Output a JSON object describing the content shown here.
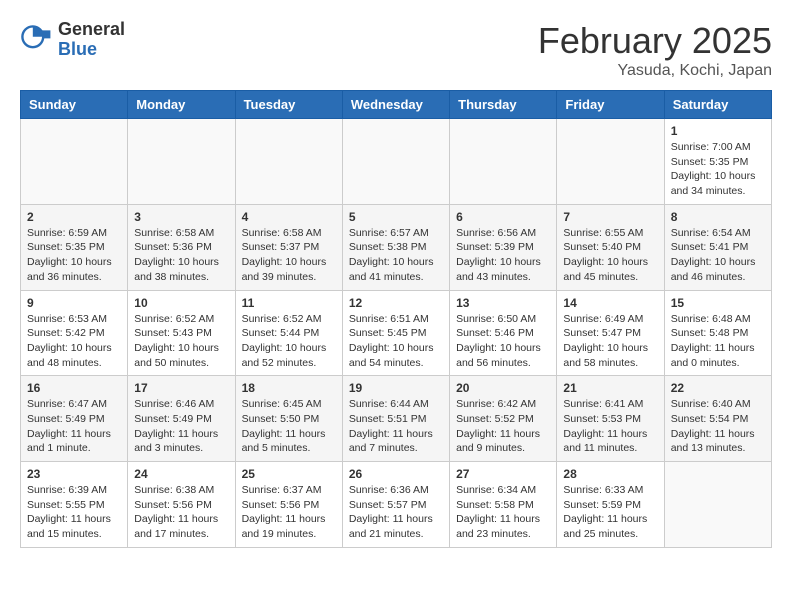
{
  "logo": {
    "general": "General",
    "blue": "Blue"
  },
  "header": {
    "title": "February 2025",
    "subtitle": "Yasuda, Kochi, Japan"
  },
  "weekdays": [
    "Sunday",
    "Monday",
    "Tuesday",
    "Wednesday",
    "Thursday",
    "Friday",
    "Saturday"
  ],
  "weeks": [
    [
      {
        "day": "",
        "info": ""
      },
      {
        "day": "",
        "info": ""
      },
      {
        "day": "",
        "info": ""
      },
      {
        "day": "",
        "info": ""
      },
      {
        "day": "",
        "info": ""
      },
      {
        "day": "",
        "info": ""
      },
      {
        "day": "1",
        "info": "Sunrise: 7:00 AM\nSunset: 5:35 PM\nDaylight: 10 hours and 34 minutes."
      }
    ],
    [
      {
        "day": "2",
        "info": "Sunrise: 6:59 AM\nSunset: 5:35 PM\nDaylight: 10 hours and 36 minutes."
      },
      {
        "day": "3",
        "info": "Sunrise: 6:58 AM\nSunset: 5:36 PM\nDaylight: 10 hours and 38 minutes."
      },
      {
        "day": "4",
        "info": "Sunrise: 6:58 AM\nSunset: 5:37 PM\nDaylight: 10 hours and 39 minutes."
      },
      {
        "day": "5",
        "info": "Sunrise: 6:57 AM\nSunset: 5:38 PM\nDaylight: 10 hours and 41 minutes."
      },
      {
        "day": "6",
        "info": "Sunrise: 6:56 AM\nSunset: 5:39 PM\nDaylight: 10 hours and 43 minutes."
      },
      {
        "day": "7",
        "info": "Sunrise: 6:55 AM\nSunset: 5:40 PM\nDaylight: 10 hours and 45 minutes."
      },
      {
        "day": "8",
        "info": "Sunrise: 6:54 AM\nSunset: 5:41 PM\nDaylight: 10 hours and 46 minutes."
      }
    ],
    [
      {
        "day": "9",
        "info": "Sunrise: 6:53 AM\nSunset: 5:42 PM\nDaylight: 10 hours and 48 minutes."
      },
      {
        "day": "10",
        "info": "Sunrise: 6:52 AM\nSunset: 5:43 PM\nDaylight: 10 hours and 50 minutes."
      },
      {
        "day": "11",
        "info": "Sunrise: 6:52 AM\nSunset: 5:44 PM\nDaylight: 10 hours and 52 minutes."
      },
      {
        "day": "12",
        "info": "Sunrise: 6:51 AM\nSunset: 5:45 PM\nDaylight: 10 hours and 54 minutes."
      },
      {
        "day": "13",
        "info": "Sunrise: 6:50 AM\nSunset: 5:46 PM\nDaylight: 10 hours and 56 minutes."
      },
      {
        "day": "14",
        "info": "Sunrise: 6:49 AM\nSunset: 5:47 PM\nDaylight: 10 hours and 58 minutes."
      },
      {
        "day": "15",
        "info": "Sunrise: 6:48 AM\nSunset: 5:48 PM\nDaylight: 11 hours and 0 minutes."
      }
    ],
    [
      {
        "day": "16",
        "info": "Sunrise: 6:47 AM\nSunset: 5:49 PM\nDaylight: 11 hours and 1 minute."
      },
      {
        "day": "17",
        "info": "Sunrise: 6:46 AM\nSunset: 5:49 PM\nDaylight: 11 hours and 3 minutes."
      },
      {
        "day": "18",
        "info": "Sunrise: 6:45 AM\nSunset: 5:50 PM\nDaylight: 11 hours and 5 minutes."
      },
      {
        "day": "19",
        "info": "Sunrise: 6:44 AM\nSunset: 5:51 PM\nDaylight: 11 hours and 7 minutes."
      },
      {
        "day": "20",
        "info": "Sunrise: 6:42 AM\nSunset: 5:52 PM\nDaylight: 11 hours and 9 minutes."
      },
      {
        "day": "21",
        "info": "Sunrise: 6:41 AM\nSunset: 5:53 PM\nDaylight: 11 hours and 11 minutes."
      },
      {
        "day": "22",
        "info": "Sunrise: 6:40 AM\nSunset: 5:54 PM\nDaylight: 11 hours and 13 minutes."
      }
    ],
    [
      {
        "day": "23",
        "info": "Sunrise: 6:39 AM\nSunset: 5:55 PM\nDaylight: 11 hours and 15 minutes."
      },
      {
        "day": "24",
        "info": "Sunrise: 6:38 AM\nSunset: 5:56 PM\nDaylight: 11 hours and 17 minutes."
      },
      {
        "day": "25",
        "info": "Sunrise: 6:37 AM\nSunset: 5:56 PM\nDaylight: 11 hours and 19 minutes."
      },
      {
        "day": "26",
        "info": "Sunrise: 6:36 AM\nSunset: 5:57 PM\nDaylight: 11 hours and 21 minutes."
      },
      {
        "day": "27",
        "info": "Sunrise: 6:34 AM\nSunset: 5:58 PM\nDaylight: 11 hours and 23 minutes."
      },
      {
        "day": "28",
        "info": "Sunrise: 6:33 AM\nSunset: 5:59 PM\nDaylight: 11 hours and 25 minutes."
      },
      {
        "day": "",
        "info": ""
      }
    ]
  ]
}
